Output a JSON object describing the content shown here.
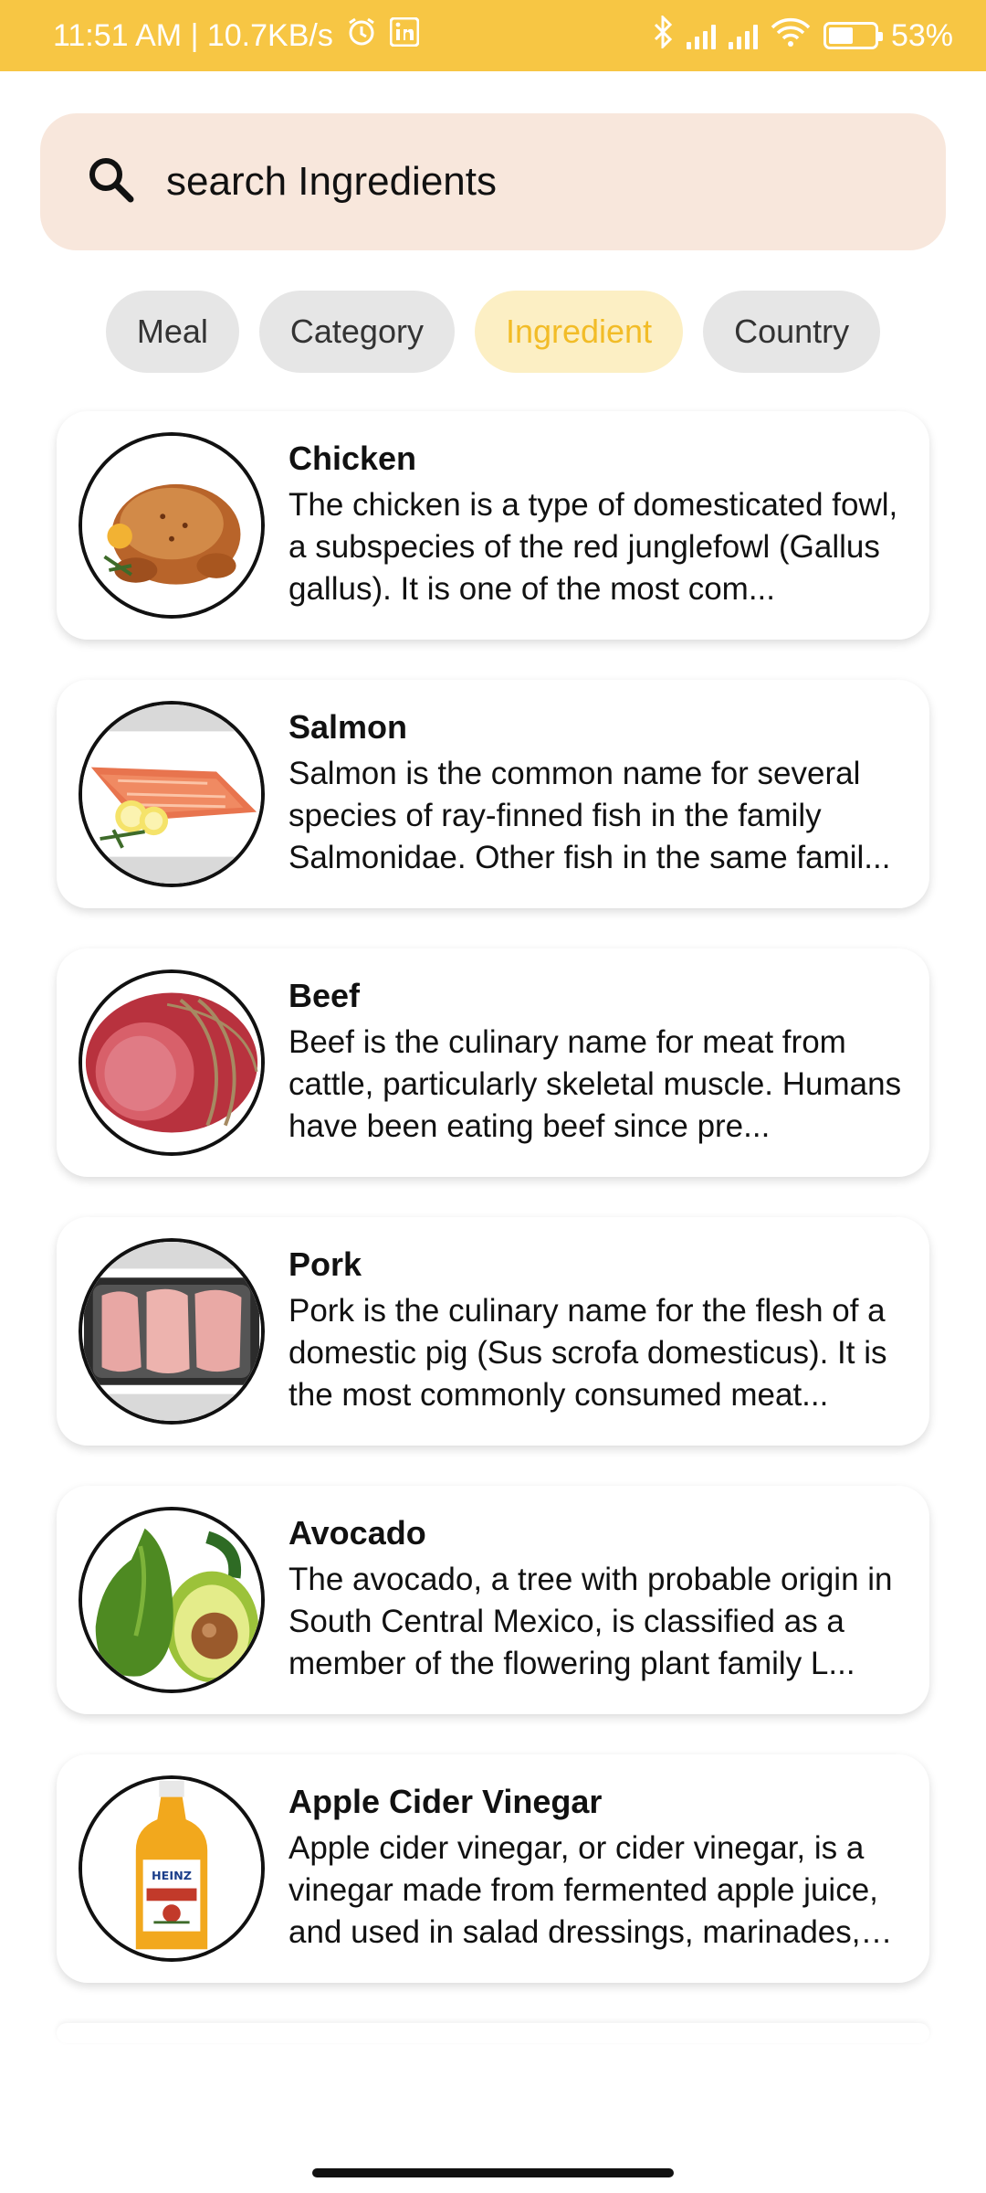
{
  "status_bar": {
    "time_speed": "11:51 AM | 10.7KB/s",
    "battery": "53%",
    "background": "#F7C644"
  },
  "search": {
    "placeholder": "search Ingredients",
    "background": "#F8E7DC"
  },
  "filter_chips": [
    {
      "label": "Meal",
      "active": false
    },
    {
      "label": "Category",
      "active": false
    },
    {
      "label": "Ingredient",
      "active": true
    },
    {
      "label": "Country",
      "active": false
    }
  ],
  "colors": {
    "accent": "#F2BC27",
    "accent_bg": "#FCEFC4",
    "chip_bg": "#E6E6E6"
  },
  "ingredients": [
    {
      "name": "Chicken",
      "description": "The chicken is a type of domesticated fowl, a subspecies of the red junglefowl (Gallus gallus). It is one of the most com...",
      "icon": "chicken-image"
    },
    {
      "name": "Salmon",
      "description": "Salmon is the common name for several species of ray-finned fish in the family Salmonidae. Other fish in the same famil...",
      "icon": "salmon-image"
    },
    {
      "name": "Beef",
      "description": "Beef is the culinary name for meat from cattle, particularly skeletal muscle. Humans have been eating beef since pre...",
      "icon": "beef-image"
    },
    {
      "name": "Pork",
      "description": "Pork is the culinary name for the flesh of a domestic pig (Sus scrofa domesticus). It is the most commonly consumed meat...",
      "icon": "pork-image"
    },
    {
      "name": "Avocado",
      "description": "The avocado, a tree with probable origin in South Central Mexico, is classified as a member of the flowering plant family L...",
      "icon": "avocado-image"
    },
    {
      "name": "Apple Cider Vinegar",
      "description": "Apple cider vinegar, or cider vinegar, is a vinegar made from fermented apple juice, and used in salad dressings, marinades, vi...",
      "icon": "vinegar-bottle-image",
      "bottle_label": "HEINZ VINEGAR"
    }
  ]
}
